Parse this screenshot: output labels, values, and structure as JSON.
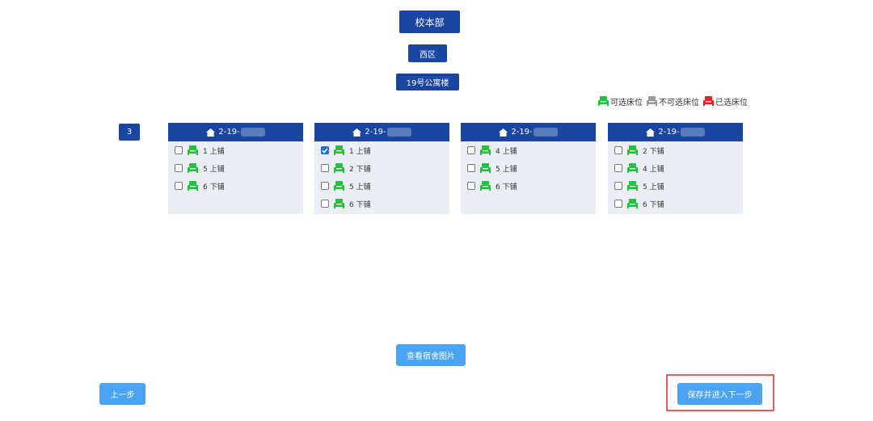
{
  "header": {
    "campus": "校本部",
    "area": "西区",
    "building": "19号公寓楼"
  },
  "legend": {
    "available": "可选床位",
    "unavailable": "不可选床位",
    "selected": "已选床位"
  },
  "colors": {
    "primary": "#1a45a0",
    "available": "#1fc33a",
    "unavailable": "#9a9a9a",
    "selected": "#f02020",
    "button": "#4aa3f5",
    "highlight": "#e8595a"
  },
  "floor": "3",
  "rooms": [
    {
      "name": "2-19-",
      "beds": [
        {
          "label": "1 上铺",
          "checked": false
        },
        {
          "label": "5 上铺",
          "checked": false
        },
        {
          "label": "6 下铺",
          "checked": false
        }
      ]
    },
    {
      "name": "2-19-",
      "beds": [
        {
          "label": "1 上铺",
          "checked": true
        },
        {
          "label": "2 下铺",
          "checked": false
        },
        {
          "label": "5 上铺",
          "checked": false
        },
        {
          "label": "6 下铺",
          "checked": false
        }
      ]
    },
    {
      "name": "2-19-",
      "beds": [
        {
          "label": "4 上铺",
          "checked": false
        },
        {
          "label": "5 上铺",
          "checked": false
        },
        {
          "label": "6 下铺",
          "checked": false
        }
      ]
    },
    {
      "name": "2-19-",
      "beds": [
        {
          "label": "2 下铺",
          "checked": false
        },
        {
          "label": "4 上铺",
          "checked": false
        },
        {
          "label": "5 上铺",
          "checked": false
        },
        {
          "label": "6 下铺",
          "checked": false
        }
      ]
    }
  ],
  "actions": {
    "view_photos": "查看宿舍图片",
    "prev": "上一步",
    "save_next": "保存并进入下一步"
  }
}
